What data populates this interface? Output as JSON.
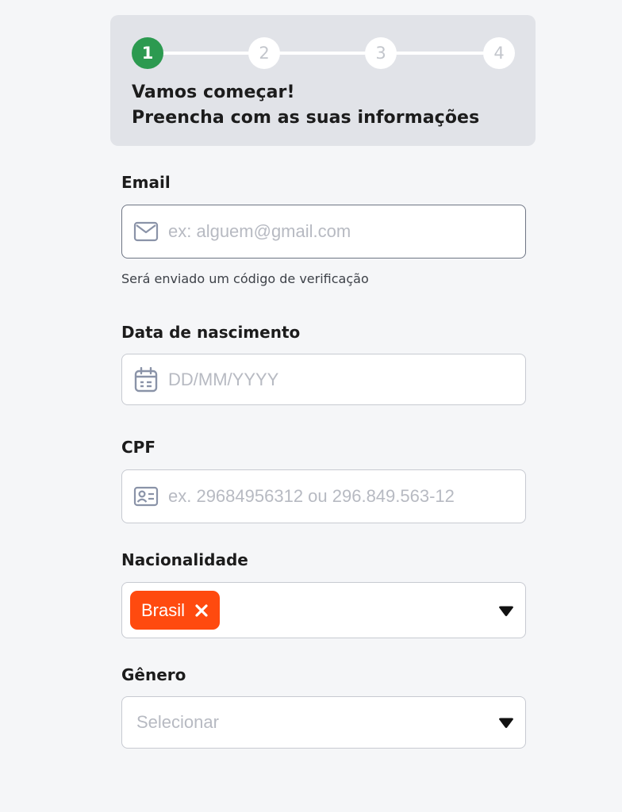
{
  "stepper": {
    "steps": [
      "1",
      "2",
      "3",
      "4"
    ],
    "active_step": 1,
    "title": "Vamos começar!",
    "subtitle": "Preencha com as suas informações"
  },
  "form": {
    "email": {
      "label": "Email",
      "placeholder": "ex: alguem@gmail.com",
      "helper": "Será enviado um código de verificação",
      "icon": "mail-icon"
    },
    "birthdate": {
      "label": "Data de nascimento",
      "placeholder": "DD/MM/YYYY",
      "icon": "calendar-icon"
    },
    "cpf": {
      "label": "CPF",
      "placeholder": "ex. 29684956312 ou 296.849.563-12",
      "icon": "id-card-icon"
    },
    "nationality": {
      "label": "Nacionalidade",
      "selected": "Brasil",
      "icon": "caret-down-icon"
    },
    "gender": {
      "label": "Gênero",
      "placeholder": "Selecionar",
      "icon": "caret-down-icon"
    }
  },
  "colors": {
    "active_step": "#2c9a50",
    "chip": "#ff4a0f",
    "card_bg": "#e1e3e8",
    "page_bg": "#f5f6f8"
  }
}
